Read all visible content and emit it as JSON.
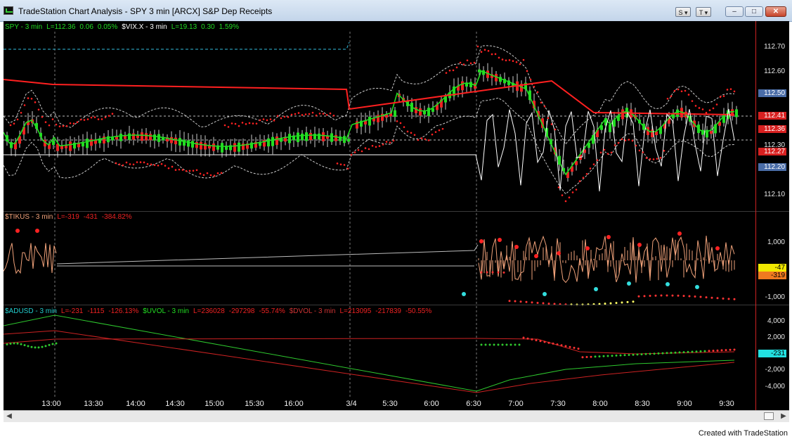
{
  "window": {
    "title": "TradeStation Chart Analysis - SPY 3 min [ARCX] S&P Dep Receipts",
    "btn_s": "S ▾",
    "btn_t": "T ▾",
    "minimize": "–",
    "maximize": "□",
    "close": "✕"
  },
  "colors": {
    "background": "#000000",
    "price_green": "#22dd22",
    "price_red": "#ee2222",
    "moving_avg_red": "#ff2020",
    "bollinger": "#cccccc",
    "vix": "#ffffff",
    "parabolic_sar": "#ff2222",
    "tick_bars": "#f0a27a",
    "adv_green": "#2ec82e",
    "dvol_red": "#cc2222"
  },
  "pane1": {
    "legend": [
      {
        "text": "SPY - 3 min",
        "color": "#22dd22"
      },
      {
        "text": "L=112.36",
        "color": "#22dd22"
      },
      {
        "text": "0.06",
        "color": "#22dd22"
      },
      {
        "text": "0.05%",
        "color": "#22dd22"
      },
      {
        "text": "$VIX.X - 3 min",
        "color": "#ffffff"
      },
      {
        "text": "L=19.13",
        "color": "#22dd22"
      },
      {
        "text": "0.30",
        "color": "#22dd22"
      },
      {
        "text": "1.59%",
        "color": "#22dd22"
      }
    ],
    "y_ticks": [
      "112.70",
      "112.60",
      "112.30",
      "112.10"
    ],
    "y_tags": [
      {
        "text": "112.50",
        "bg": "#4a6da8",
        "fg": "#ffffff"
      },
      {
        "text": "112.41",
        "bg": "#d82020",
        "fg": "#ffffff"
      },
      {
        "text": "112.36",
        "bg": "#d82020",
        "fg": "#ffffff"
      },
      {
        "text": "112.27",
        "bg": "#d82020",
        "fg": "#ffffff"
      },
      {
        "text": "112.20",
        "bg": "#4a6da8",
        "fg": "#ffffff"
      }
    ]
  },
  "pane2": {
    "legend": [
      {
        "text": "$TIKUS - 3 min",
        "color": "#f0a27a"
      },
      {
        "text": "L=-319",
        "color": "#ee2222"
      },
      {
        "text": "-431",
        "color": "#ee2222"
      },
      {
        "text": "-384.82%",
        "color": "#ee2222"
      }
    ],
    "y_ticks": [
      "1,000",
      "-1,000"
    ],
    "y_tags": [
      {
        "text": "-47",
        "bg": "#f0e800",
        "fg": "#000000"
      },
      {
        "text": "-319",
        "bg": "#f07a20",
        "fg": "#000000"
      }
    ]
  },
  "pane3": {
    "legend": [
      {
        "text": "$ADUSD - 3 min",
        "color": "#22cccc"
      },
      {
        "text": "L=-231",
        "color": "#ee2222"
      },
      {
        "text": "-1115",
        "color": "#ee2222"
      },
      {
        "text": "-126.13%",
        "color": "#ee2222"
      },
      {
        "text": "$UVOL - 3 min",
        "color": "#22dd22"
      },
      {
        "text": "L=236028",
        "color": "#ee2222"
      },
      {
        "text": "-297298",
        "color": "#ee2222"
      },
      {
        "text": "-55.74%",
        "color": "#ee2222"
      },
      {
        "text": "$DVOL - 3 min",
        "color": "#cc3333"
      },
      {
        "text": "L=213095",
        "color": "#ee2222"
      },
      {
        "text": "-217839",
        "color": "#ee2222"
      },
      {
        "text": "-50.55%",
        "color": "#ee2222"
      }
    ],
    "y_ticks": [
      "4,000",
      "2,000",
      "-2,000",
      "-4,000"
    ],
    "y_tags": [
      {
        "text": "-231",
        "bg": "#22e0e0",
        "fg": "#000000"
      }
    ]
  },
  "x_axis": [
    "13:00",
    "13:30",
    "14:00",
    "14:30",
    "15:00",
    "15:30",
    "16:00",
    "3/4",
    "5:30",
    "6:00",
    "6:30",
    "7:00",
    "7:30",
    "8:00",
    "8:30",
    "9:00",
    "9:30"
  ],
  "footer": {
    "credit": "Created with TradeStation"
  }
}
